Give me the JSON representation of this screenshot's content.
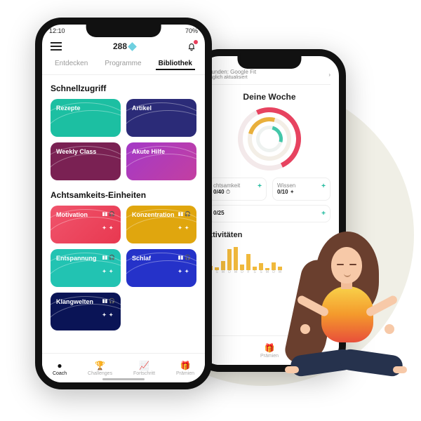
{
  "status": {
    "time": "12:10",
    "battery": "70%"
  },
  "header": {
    "points": "288"
  },
  "tabs": [
    {
      "label": "Entdecken",
      "active": false
    },
    {
      "label": "Programme",
      "active": false
    },
    {
      "label": "Bibliothek",
      "active": true
    }
  ],
  "sections": {
    "quick": {
      "title": "Schnellzugriff",
      "cards": [
        {
          "label": "Rezepte",
          "cls": "c-teal"
        },
        {
          "label": "Artikel",
          "cls": "c-indigo"
        },
        {
          "label": "Weekly Class",
          "cls": "c-maroon"
        },
        {
          "label": "Akute Hilfe",
          "cls": "c-purple"
        }
      ]
    },
    "mind": {
      "title": "Achtsamkeits-Einheiten",
      "cards": [
        {
          "label": "Motivation",
          "cls": "c-red",
          "icons": true
        },
        {
          "label": "Konzentration",
          "cls": "c-gold",
          "icons": true
        },
        {
          "label": "Entspannung",
          "cls": "c-teal2",
          "icons": true
        },
        {
          "label": "Schlaf",
          "cls": "c-blue",
          "icons": true
        },
        {
          "label": "Klangwelten",
          "cls": "c-navy",
          "icons": true
        }
      ]
    }
  },
  "bottomnav": [
    {
      "label": "Coach",
      "icon": "●",
      "active": true
    },
    {
      "label": "Challenges",
      "icon": "🏆",
      "active": false
    },
    {
      "label": "Fortschritt",
      "icon": "📈",
      "active": false
    },
    {
      "label": "Prämien",
      "icon": "🎁",
      "active": false
    }
  ],
  "back_phone": {
    "source_line": "bunden: Google Fit",
    "source_sub": "täglich aktualisiert",
    "week_title": "Deine Woche",
    "stats": [
      {
        "label": "chtsamkeit",
        "value": "0/40",
        "unit": "⏱"
      },
      {
        "label": "Wissen",
        "value": "0/10",
        "unit": "✦"
      },
      {
        "label": "",
        "value": "0/25",
        "unit": ""
      }
    ],
    "activities_title": "ktivitäten",
    "bottomnav": [
      {
        "label": "",
        "icon": ""
      },
      {
        "label": "Prämien",
        "icon": "🎁"
      }
    ],
    "chart_data": {
      "type": "bar",
      "categories": [
        "S",
        "S",
        "M",
        "D",
        "M",
        "D",
        "F",
        "S",
        "S",
        "M",
        "D",
        "M"
      ],
      "values": [
        5,
        3,
        10,
        24,
        26,
        6,
        18,
        4,
        8,
        2,
        9,
        4
      ],
      "ylim": [
        0,
        30
      ]
    }
  }
}
